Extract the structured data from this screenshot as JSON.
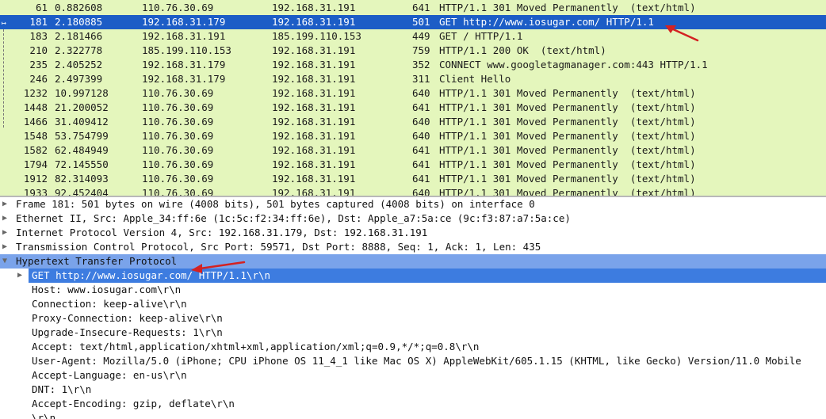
{
  "packets": [
    {
      "no": "61",
      "time": "0.882608",
      "src": "110.76.30.69",
      "dst": "192.168.31.191",
      "len": "641",
      "info": "HTTP/1.1 301 Moved Permanently  (text/html)"
    },
    {
      "no": "181",
      "time": "2.180885",
      "src": "192.168.31.179",
      "dst": "192.168.31.191",
      "len": "501",
      "info": "GET http://www.iosugar.com/ HTTP/1.1"
    },
    {
      "no": "183",
      "time": "2.181466",
      "src": "192.168.31.191",
      "dst": "185.199.110.153",
      "len": "449",
      "info": "GET / HTTP/1.1"
    },
    {
      "no": "210",
      "time": "2.322778",
      "src": "185.199.110.153",
      "dst": "192.168.31.191",
      "len": "759",
      "info": "HTTP/1.1 200 OK  (text/html)"
    },
    {
      "no": "235",
      "time": "2.405252",
      "src": "192.168.31.179",
      "dst": "192.168.31.191",
      "len": "352",
      "info": "CONNECT www.googletagmanager.com:443 HTTP/1.1"
    },
    {
      "no": "246",
      "time": "2.497399",
      "src": "192.168.31.179",
      "dst": "192.168.31.191",
      "len": "311",
      "info": "Client Hello"
    },
    {
      "no": "1232",
      "time": "10.997128",
      "src": "110.76.30.69",
      "dst": "192.168.31.191",
      "len": "640",
      "info": "HTTP/1.1 301 Moved Permanently  (text/html)"
    },
    {
      "no": "1448",
      "time": "21.200052",
      "src": "110.76.30.69",
      "dst": "192.168.31.191",
      "len": "641",
      "info": "HTTP/1.1 301 Moved Permanently  (text/html)"
    },
    {
      "no": "1466",
      "time": "31.409412",
      "src": "110.76.30.69",
      "dst": "192.168.31.191",
      "len": "640",
      "info": "HTTP/1.1 301 Moved Permanently  (text/html)"
    },
    {
      "no": "1548",
      "time": "53.754799",
      "src": "110.76.30.69",
      "dst": "192.168.31.191",
      "len": "640",
      "info": "HTTP/1.1 301 Moved Permanently  (text/html)"
    },
    {
      "no": "1582",
      "time": "62.484949",
      "src": "110.76.30.69",
      "dst": "192.168.31.191",
      "len": "641",
      "info": "HTTP/1.1 301 Moved Permanently  (text/html)"
    },
    {
      "no": "1794",
      "time": "72.145550",
      "src": "110.76.30.69",
      "dst": "192.168.31.191",
      "len": "641",
      "info": "HTTP/1.1 301 Moved Permanently  (text/html)"
    },
    {
      "no": "1912",
      "time": "82.314093",
      "src": "110.76.30.69",
      "dst": "192.168.31.191",
      "len": "641",
      "info": "HTTP/1.1 301 Moved Permanently  (text/html)"
    },
    {
      "no": "1933",
      "time": "92.452404",
      "src": "110.76.30.69",
      "dst": "192.168.31.191",
      "len": "640",
      "info": "HTTP/1.1 301 Moved Permanently  (text/html)"
    }
  ],
  "details": {
    "frame": "Frame 181: 501 bytes on wire (4008 bits), 501 bytes captured (4008 bits) on interface 0",
    "ethernet": "Ethernet II, Src: Apple_34:ff:6e (1c:5c:f2:34:ff:6e), Dst: Apple_a7:5a:ce (9c:f3:87:a7:5a:ce)",
    "ip": "Internet Protocol Version 4, Src: 192.168.31.179, Dst: 192.168.31.191",
    "tcp": "Transmission Control Protocol, Src Port: 59571, Dst Port: 8888, Seq: 1, Ack: 1, Len: 435",
    "http": "Hypertext Transfer Protocol",
    "http_request_line": "GET http://www.iosugar.com/ HTTP/1.1\\r\\n",
    "http_headers": [
      "Host: www.iosugar.com\\r\\n",
      "Connection: keep-alive\\r\\n",
      "Proxy-Connection: keep-alive\\r\\n",
      "Upgrade-Insecure-Requests: 1\\r\\n",
      "Accept: text/html,application/xhtml+xml,application/xml;q=0.9,*/*;q=0.8\\r\\n",
      "User-Agent: Mozilla/5.0 (iPhone; CPU iPhone OS 11_4_1 like Mac OS X) AppleWebKit/605.1.15 (KHTML, like Gecko) Version/11.0 Mobile",
      "Accept-Language: en-us\\r\\n",
      "DNT: 1\\r\\n",
      "Accept-Encoding: gzip, deflate\\r\\n",
      "\\r\\n"
    ]
  },
  "icons": {
    "collapsed": "▶",
    "expanded": "▼",
    "selected_marker": "↦"
  },
  "colors": {
    "list_bg": "#e4f6bc",
    "selected_row": "#1c5dc6",
    "tree_highlight": "#7aa3ea",
    "tree_selected": "#3d7ce0",
    "annotation_arrow": "#d42222"
  }
}
